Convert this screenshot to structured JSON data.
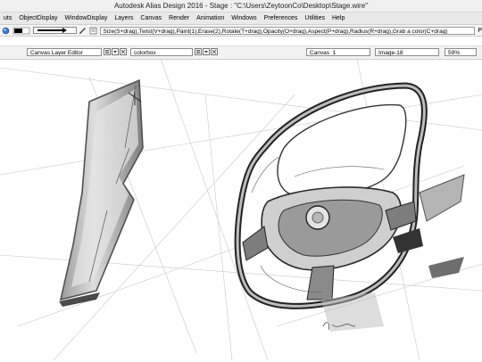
{
  "window": {
    "title": "Autodesk Alias Design 2016    -  Stage : \"C:\\Users\\ZeytoonCo\\Desktop\\Stage.wire\""
  },
  "menubar": {
    "items": [
      "uts",
      "ObjectDisplay",
      "WindowDisplay",
      "Layers",
      "Canvas",
      "Render",
      "Animation",
      "Windows",
      "Preferences",
      "Utilities",
      "Help"
    ]
  },
  "toolbar": {
    "hint": "Size(S+drag),Twist(V+drag),Paint(1),Erase(2),Rotate(T+drag),Opacity(O+drag),Aspect(P+drag),Radius(R+drag),Grab a color(C+drag)",
    "right_label": "P"
  },
  "panels": {
    "canvas_layer_editor": "Canvas Layer Editor",
    "colorbox": "colorbox",
    "canvas_name": "Canvas_1",
    "image_name": "Image-18",
    "zoom": "59%"
  },
  "icons": {
    "brush": "paint-brush-icon",
    "pencil": "pencil-icon",
    "menu": "menu-icon",
    "close": "close-icon",
    "dropdown": "chevron-down-icon"
  }
}
